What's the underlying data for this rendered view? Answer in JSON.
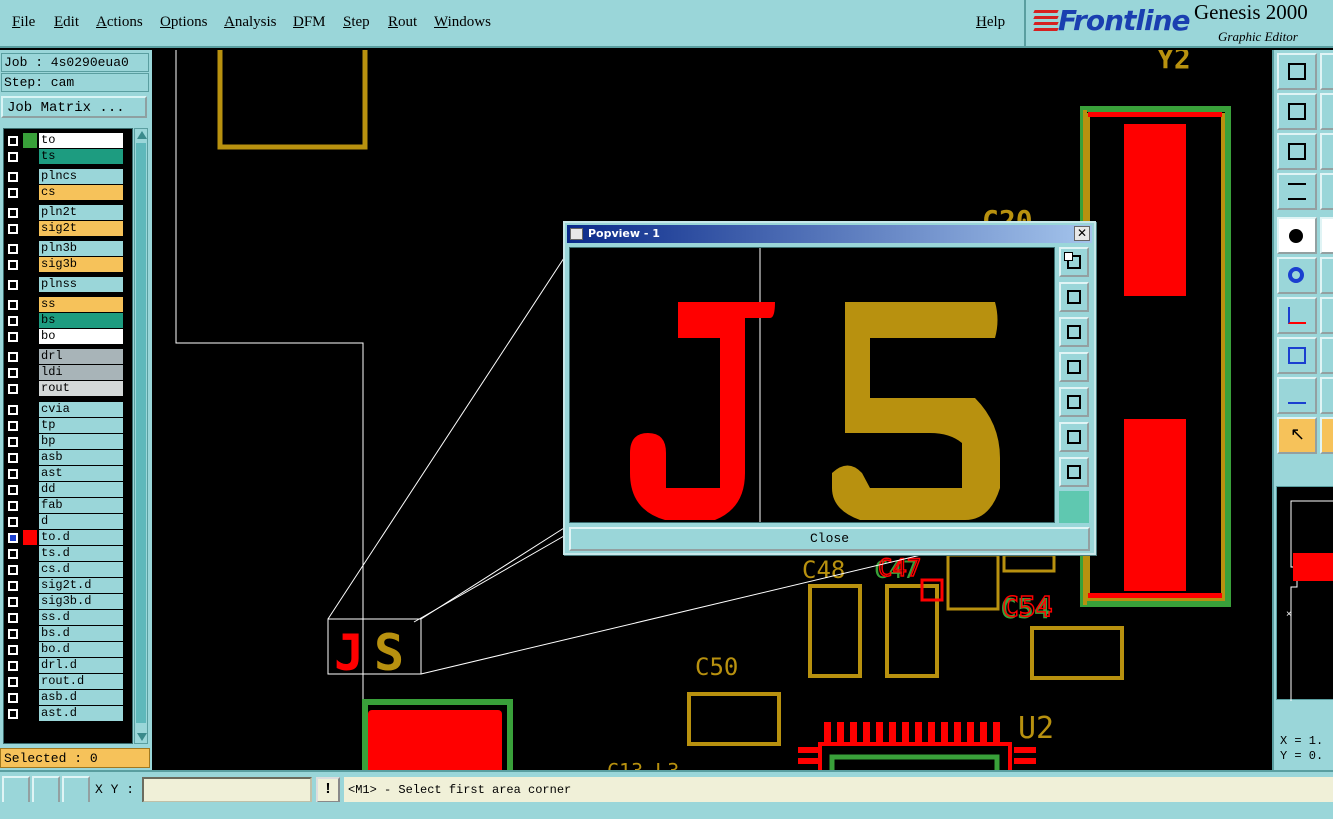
{
  "menu": {
    "items": [
      "File",
      "Edit",
      "Actions",
      "Options",
      "Analysis",
      "DFM",
      "Step",
      "Rout",
      "Windows"
    ],
    "help": "Help"
  },
  "logo": {
    "brand": "Frontline",
    "product": "Genesis 2000",
    "subtitle": "Graphic Editor"
  },
  "left_panel": {
    "job": "Job : 4s0290eua0",
    "step": "Step: cam",
    "job_matrix_label": "Job Matrix ...",
    "selected": "Selected : 0",
    "layers": [
      {
        "name": "to",
        "color": "#ffffff",
        "swatch": "#39a03a"
      },
      {
        "name": "ts",
        "color": "#1d9c80",
        "swatch": "#000000"
      },
      {
        "name": "plncs",
        "color": "#9ad6d9",
        "swatch": "#000000"
      },
      {
        "name": "cs",
        "color": "#f6c25a",
        "swatch": "#000000"
      },
      {
        "name": "pln2t",
        "color": "#9ad6d9",
        "swatch": "#000000"
      },
      {
        "name": "sig2t",
        "color": "#f6c25a",
        "swatch": "#000000"
      },
      {
        "name": "pln3b",
        "color": "#9ad6d9",
        "swatch": "#000000"
      },
      {
        "name": "sig3b",
        "color": "#f6c25a",
        "swatch": "#000000"
      },
      {
        "name": "plnss",
        "color": "#9ad6d9",
        "swatch": "#000000"
      },
      {
        "name": "ss",
        "color": "#f6c25a",
        "swatch": "#000000"
      },
      {
        "name": "bs",
        "color": "#1d9c80",
        "swatch": "#000000"
      },
      {
        "name": "bo",
        "color": "#ffffff",
        "swatch": "#000000"
      },
      {
        "name": "drl",
        "color": "#a8b4b8",
        "swatch": "#000000"
      },
      {
        "name": "ldi",
        "color": "#a8b4b8",
        "swatch": "#000000"
      },
      {
        "name": "rout",
        "color": "#d4d8d8",
        "swatch": "#000000"
      },
      {
        "name": "cvia",
        "color": "#9ad6d9",
        "swatch": "#000000"
      },
      {
        "name": "tp",
        "color": "#9ad6d9",
        "swatch": "#000000"
      },
      {
        "name": "bp",
        "color": "#9ad6d9",
        "swatch": "#000000"
      },
      {
        "name": "asb",
        "color": "#9ad6d9",
        "swatch": "#000000"
      },
      {
        "name": "ast",
        "color": "#9ad6d9",
        "swatch": "#000000"
      },
      {
        "name": "dd",
        "color": "#9ad6d9",
        "swatch": "#000000"
      },
      {
        "name": "fab",
        "color": "#9ad6d9",
        "swatch": "#000000"
      },
      {
        "name": "d",
        "color": "#9ad6d9",
        "swatch": "#000000"
      },
      {
        "name": "to.d",
        "color": "#9ad6d9",
        "swatch": "#ff0000"
      },
      {
        "name": "ts.d",
        "color": "#9ad6d9",
        "swatch": "#000000"
      },
      {
        "name": "cs.d",
        "color": "#9ad6d9",
        "swatch": "#000000"
      },
      {
        "name": "sig2t.d",
        "color": "#9ad6d9",
        "swatch": "#000000"
      },
      {
        "name": "sig3b.d",
        "color": "#9ad6d9",
        "swatch": "#000000"
      },
      {
        "name": "ss.d",
        "color": "#9ad6d9",
        "swatch": "#000000"
      },
      {
        "name": "bs.d",
        "color": "#9ad6d9",
        "swatch": "#000000"
      },
      {
        "name": "bo.d",
        "color": "#9ad6d9",
        "swatch": "#000000"
      },
      {
        "name": "drl.d",
        "color": "#9ad6d9",
        "swatch": "#000000"
      },
      {
        "name": "rout.d",
        "color": "#9ad6d9",
        "swatch": "#000000"
      },
      {
        "name": "asb.d",
        "color": "#9ad6d9",
        "swatch": "#000000"
      },
      {
        "name": "ast.d",
        "color": "#9ad6d9",
        "swatch": "#000000"
      }
    ]
  },
  "canvas": {
    "labels": {
      "y2": "Y2",
      "c20": "C20",
      "c48": "C48",
      "c47": "C47",
      "c50": "C50",
      "c54": "C54",
      "u2": "U2",
      "j5_j": "J",
      "j5_s": "S"
    },
    "colors": {
      "copper": "#b8910f",
      "pad": "#ff0000",
      "mask": "#39a03a",
      "outline": "#ffffff"
    }
  },
  "popview": {
    "title": "Popview - 1",
    "close_label": "Close",
    "zoom_j": "J",
    "zoom_s": "S",
    "tools": [
      "zoom-home-icon",
      "zoom-up-icon",
      "zoom-down-icon",
      "pan-left-icon",
      "pan-right-icon",
      "fit-all-icon",
      "fit-vertical-icon"
    ]
  },
  "coords": {
    "x": "X = 1.",
    "y": "Y = 0."
  },
  "status": {
    "xy_label": "X Y :",
    "xy_value": "",
    "warn": "!",
    "prompt": "<M1> - Select first area corner"
  }
}
